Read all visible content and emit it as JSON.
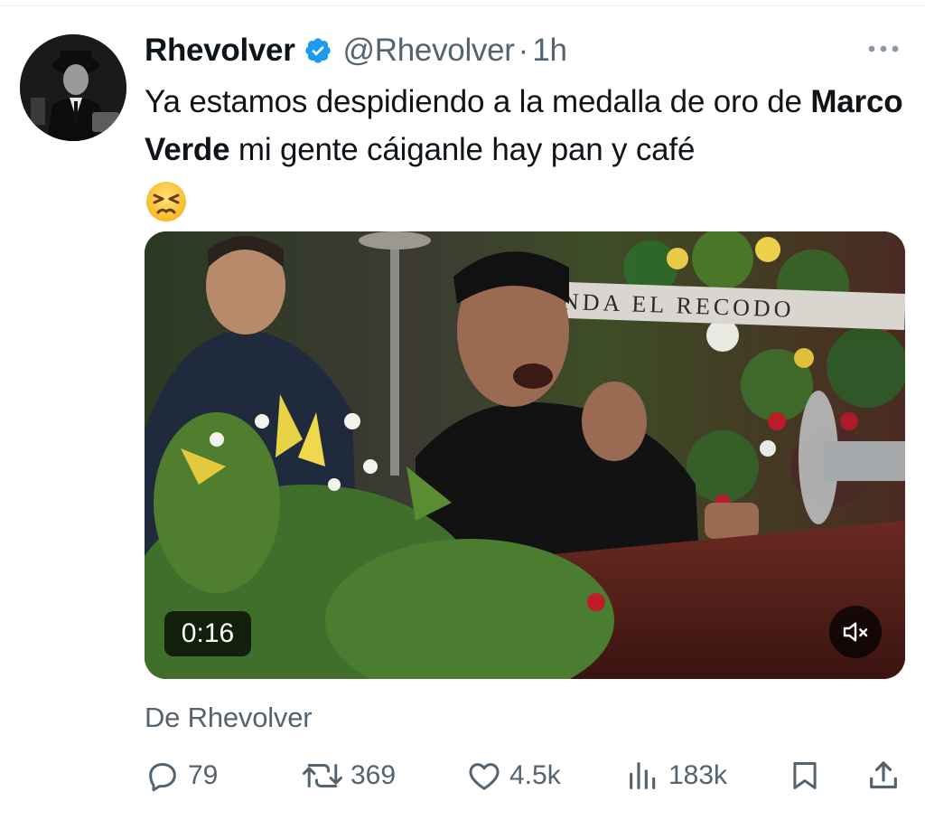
{
  "tweet": {
    "display_name": "Rhevolver",
    "handle": "@Rhevolver",
    "separator": "·",
    "time": "1h",
    "text_part1": "Ya estamos despidiendo a la medalla de oro de ",
    "text_bold": "Marco Verde",
    "text_part2": " mi gente cáiganle hay pan y café",
    "emoji": "persevering-face-emoji"
  },
  "video": {
    "duration": "0:16",
    "banner_text": "NDA EL RECODO",
    "muted": true
  },
  "source": "De Rhevolver",
  "actions": {
    "replies": "79",
    "reposts": "369",
    "likes": "4.5k",
    "views": "183k"
  },
  "colors": {
    "text": "#0f1419",
    "secondary": "#536471",
    "verified": "#1d9bf0"
  },
  "icons": [
    "more-icon",
    "verified-badge-icon",
    "reply-icon",
    "repost-icon",
    "like-icon",
    "views-icon",
    "bookmark-icon",
    "share-icon",
    "mute-icon"
  ]
}
